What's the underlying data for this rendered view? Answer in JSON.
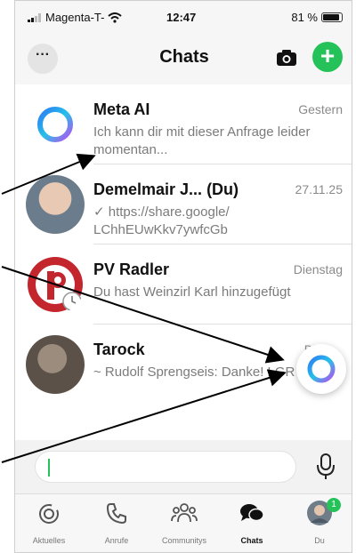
{
  "status_bar": {
    "carrier": "Magenta-T-",
    "time": "12:47",
    "battery": "81 %"
  },
  "header": {
    "title": "Chats",
    "menu_label": "···"
  },
  "chats": [
    {
      "name": "Meta AI",
      "date": "Gestern",
      "preview": "Ich kann dir mit dieser Anfrage leider momentan..."
    },
    {
      "name": "Demelmair J... (Du)",
      "date": "27.11.25",
      "preview": "✓ https://share.google/ LChhEUwKkv7ywfcGb"
    },
    {
      "name": "PV Radler",
      "date": "Dienstag",
      "preview": "Du hast Weinzirl Karl hinzugefügt"
    },
    {
      "name": "Tarock",
      "date": "Di",
      "preview": "~ Rudolf Sprengseis: Danke! LGR"
    }
  ],
  "tabs": [
    {
      "label": "Aktuelles",
      "icon": "updates-icon"
    },
    {
      "label": "Anrufe",
      "icon": "phone-icon"
    },
    {
      "label": "Communitys",
      "icon": "community-icon"
    },
    {
      "label": "Chats",
      "icon": "chats-icon"
    },
    {
      "label": "Du",
      "icon": "profile-icon",
      "badge": "1"
    }
  ],
  "colors": {
    "accent": "#25c25a",
    "meta_ring_start": "#2d7bf4",
    "meta_ring_end": "#b84ef0"
  }
}
